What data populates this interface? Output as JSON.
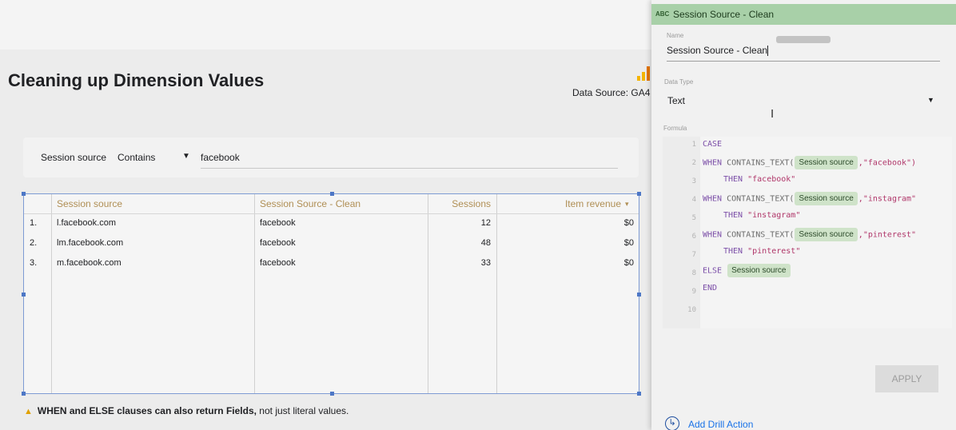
{
  "page": {
    "title": "Cleaning up Dimension Values",
    "data_source": "Data Source: GA4"
  },
  "filter": {
    "field": "Session source",
    "operator": "Contains",
    "value": "facebook"
  },
  "table": {
    "columns": [
      "Session source",
      "Session Source - Clean",
      "Sessions",
      "Item revenue"
    ],
    "sort_indicator": "▾",
    "rows": [
      {
        "index": "1.",
        "source": "l.facebook.com",
        "clean": "facebook",
        "sessions": "12",
        "revenue": "$0"
      },
      {
        "index": "2.",
        "source": "lm.facebook.com",
        "clean": "facebook",
        "sessions": "48",
        "revenue": "$0"
      },
      {
        "index": "3.",
        "source": "m.facebook.com",
        "clean": "facebook",
        "sessions": "33",
        "revenue": "$0"
      }
    ]
  },
  "note": {
    "bold": "WHEN and ELSE clauses can also return Fields,",
    "rest": " not just literal values."
  },
  "panel": {
    "header_icon": "ABC",
    "header_title": "Session Source - Clean",
    "name_label": "Name",
    "name_value": "Session Source - Clean",
    "type_label": "Data Type",
    "type_value": "Text",
    "formula_label": "Formula",
    "apply_label": "APPLY",
    "drill_label": "Add Drill Action"
  },
  "formula": {
    "line_numbers": [
      "1",
      "2",
      "3",
      "4",
      "5",
      "6",
      "7",
      "8",
      "9",
      "10"
    ],
    "case": "CASE",
    "when": "WHEN",
    "fn": "CONTAINS_TEXT(",
    "field": "Session source",
    "then": "THEN",
    "else": "ELSE",
    "end": "END",
    "str1_arg": ",\"facebook\")",
    "str1_then": "\"facebook\"",
    "str2_arg": ",\"instagram\"",
    "str2_then": "\"instagram\"",
    "str3_arg": ",\"pinterest\"",
    "str3_then": "\"pinterest\""
  },
  "colors": {
    "panel_header": "#a8d0a8",
    "field_chip": "#cfe3c9",
    "keyword": "#7c4fa8",
    "string": "#b0376a",
    "selection": "#4d77c6"
  },
  "icons": {
    "data_source": "bar-chart-icon",
    "warning": "warning-icon",
    "drill": "drill-action-icon",
    "type_dropdown": "chevron-down-icon",
    "text_cursor": "i-beam-cursor-icon"
  }
}
